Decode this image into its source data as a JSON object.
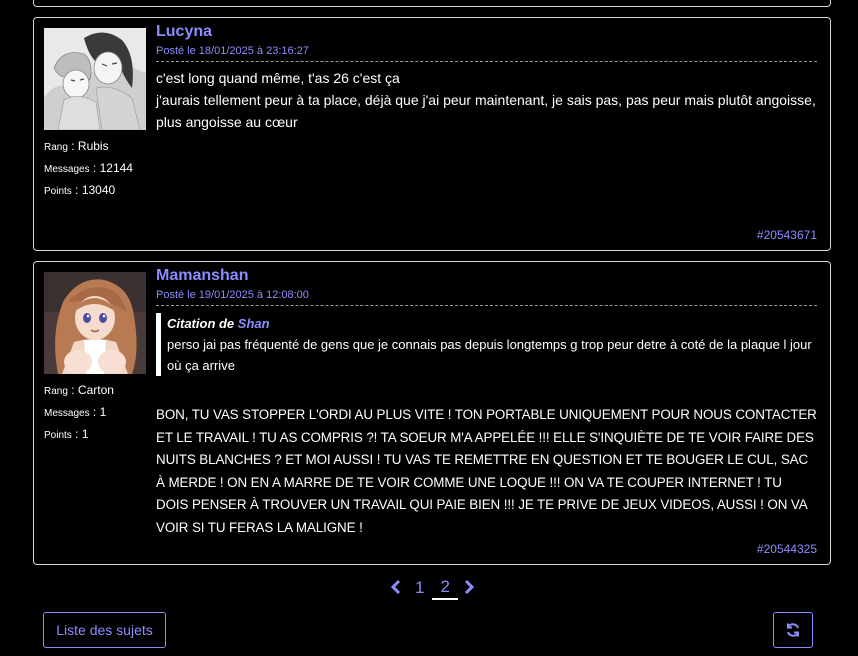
{
  "posts": [
    {
      "author": "Lucyna",
      "date": "Posté le 18/01/2025 à 23:16:27",
      "lines": [
        "c'est long quand même, t'as 26 c'est ça",
        "j'aurais tellement peur à ta place, déjà que j'ai peur maintenant, je sais pas, pas peur mais plutôt angoisse, plus angoisse au cœur"
      ],
      "rank_label": "Rang",
      "rank": "Rubis",
      "messages_label": "Messages",
      "messages": "12144",
      "points_label": "Points",
      "points": "13040",
      "post_id": "#20543671",
      "avatar_icon": "manga-couple-avatar"
    },
    {
      "author": "Mamanshan",
      "date": "Posté le 19/01/2025 à 12:08:00",
      "quote": {
        "prefix": "Citation de",
        "author": "Shan",
        "text": "perso jai pas fréquenté de gens que je connais pas depuis longtemps g trop peur detre à coté de la plaque l jour où ça arrive"
      },
      "body": "BON, TU VAS STOPPER L'ORDI AU PLUS VITE ! TON PORTABLE UNIQUEMENT POUR NOUS CONTACTER ET LE TRAVAIL ! TU AS COMPRIS ?! TA SOEUR M'A APPELÉE !!! ELLE S'INQUIÈTE DE TE VOIR FAIRE DES NUITS BLANCHES ? ET MOI AUSSI ! TU VAS TE REMETTRE EN QUESTION ET TE BOUGER LE CUL, SAC À MERDE ! ON EN A MARRE DE TE VOIR COMME UNE LOQUE !!! ON VA TE COUPER INTERNET ! TU DOIS PENSER À TROUVER UN TRAVAIL QUI PAIE BIEN !!! JE TE PRIVE DE JEUX VIDEOS, AUSSI ! ON VA VOIR SI TU FERAS LA MALIGNE !",
      "rank_label": "Rang",
      "rank": "Carton",
      "messages_label": "Messages",
      "messages": "1",
      "points_label": "Points",
      "points": "1",
      "post_id": "#20544325",
      "avatar_icon": "anime-woman-avatar"
    }
  ],
  "pagination": {
    "prev_icon": "chevron-left-icon",
    "pages": [
      "1",
      "2"
    ],
    "current": "2",
    "next_icon": "chevron-right-icon"
  },
  "buttons": {
    "topics_label": "Liste des sujets",
    "refresh_icon": "refresh-icon"
  },
  "colors": {
    "background": "#000000",
    "accent": "#8c8cff",
    "border": "#d6d6d6",
    "text": "#ffffff"
  }
}
